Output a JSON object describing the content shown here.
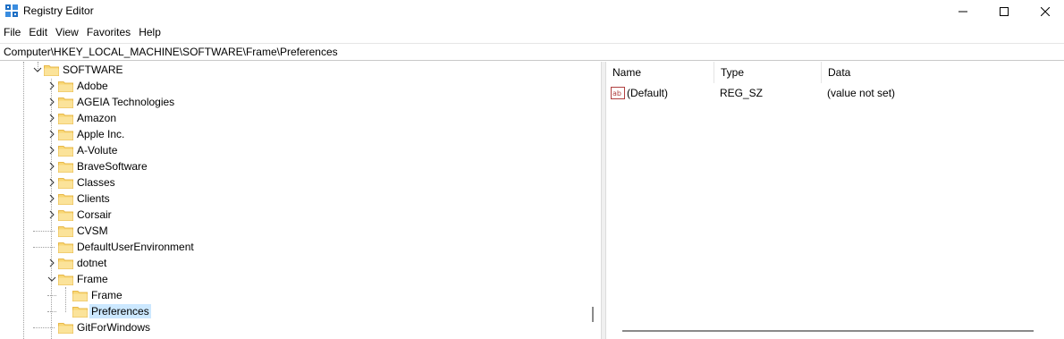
{
  "window": {
    "title": "Registry Editor",
    "icon": "registry-editor-icon"
  },
  "menu": [
    "File",
    "Edit",
    "View",
    "Favorites",
    "Help"
  ],
  "address": "Computer\\HKEY_LOCAL_MACHINE\\SOFTWARE\\Frame\\Preferences",
  "tree": {
    "root": {
      "label": "SOFTWARE",
      "expanded": true
    },
    "children": [
      {
        "label": "Adobe",
        "expandable": true
      },
      {
        "label": "AGEIA Technologies",
        "expandable": true
      },
      {
        "label": "Amazon",
        "expandable": true
      },
      {
        "label": "Apple Inc.",
        "expandable": true
      },
      {
        "label": "A-Volute",
        "expandable": true
      },
      {
        "label": "BraveSoftware",
        "expandable": true
      },
      {
        "label": "Classes",
        "expandable": true
      },
      {
        "label": "Clients",
        "expandable": true
      },
      {
        "label": "Corsair",
        "expandable": true
      },
      {
        "label": "CVSM",
        "expandable": false
      },
      {
        "label": "DefaultUserEnvironment",
        "expandable": false
      },
      {
        "label": "dotnet",
        "expandable": true
      },
      {
        "label": "Frame",
        "expandable": true,
        "expanded": true
      },
      {
        "label": "Frame",
        "expandable": false,
        "child": true
      },
      {
        "label": "Preferences",
        "expandable": false,
        "child": true,
        "selected": true
      },
      {
        "label": "GitForWindows",
        "expandable": false
      }
    ]
  },
  "list": {
    "columns": [
      "Name",
      "Type",
      "Data"
    ],
    "rows": [
      {
        "name": "(Default)",
        "type": "REG_SZ",
        "data": "(value not set)",
        "icon": "string-value-icon"
      }
    ]
  },
  "colors": {
    "selection": "#cce8ff",
    "folder": "#f8d775",
    "folder_dark": "#e8b84a"
  }
}
